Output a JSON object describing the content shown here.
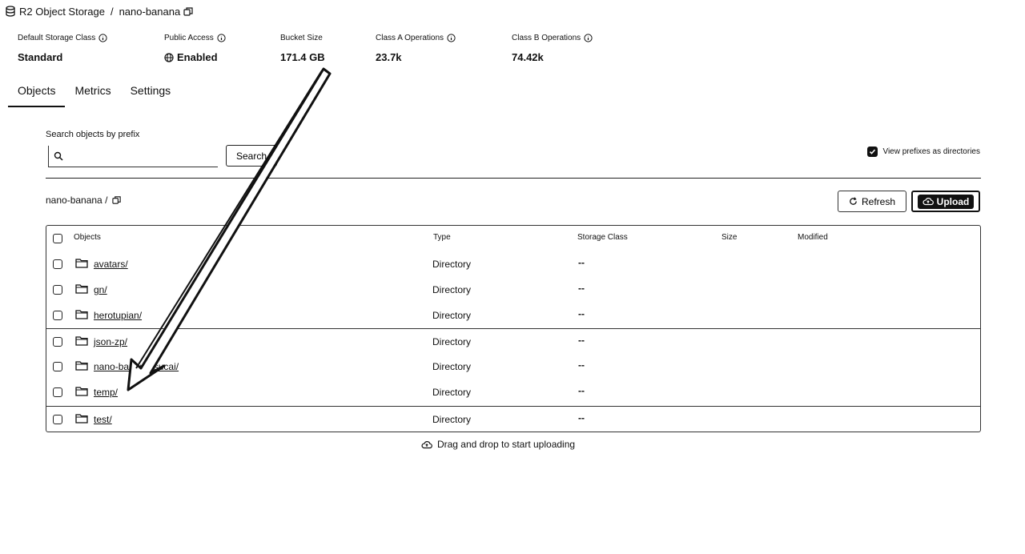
{
  "header": {
    "service": "R2 Object Storage",
    "separator": "/",
    "bucket": "nano-banana"
  },
  "stats": [
    {
      "label": "Default Storage Class",
      "value": "Standard",
      "info": true
    },
    {
      "label": "Public Access",
      "value": "Enabled",
      "info": true,
      "value_icon": "globe-icon"
    },
    {
      "label": "Bucket Size",
      "value": "171.4 GB",
      "info": false
    },
    {
      "label": "Class A Operations",
      "value": "23.7k",
      "info": true
    },
    {
      "label": "Class B Operations",
      "value": "74.42k",
      "info": true
    }
  ],
  "tabs": [
    {
      "label": "Objects",
      "active": true
    },
    {
      "label": "Metrics",
      "active": false
    },
    {
      "label": "Settings",
      "active": false
    }
  ],
  "search": {
    "label": "Search objects by prefix",
    "value": "",
    "placeholder": "",
    "button": "Search"
  },
  "view_prefixes": {
    "label": "View prefixes as directories",
    "checked": true
  },
  "path": {
    "text": "nano-banana /"
  },
  "actions": {
    "refresh": "Refresh",
    "upload": "Upload"
  },
  "table": {
    "columns": [
      "Objects",
      "Type",
      "Storage Class",
      "Size",
      "Modified"
    ],
    "rows": [
      {
        "name": "avatars/",
        "type": "Directory",
        "storage_class": "--"
      },
      {
        "name": "gn/",
        "type": "Directory",
        "storage_class": "--"
      },
      {
        "name": "herotupian/",
        "type": "Directory",
        "storage_class": "--"
      },
      {
        "name": "json-zp/",
        "type": "Directory",
        "storage_class": "--"
      },
      {
        "name": "nano-banana-sucai/",
        "type": "Directory",
        "storage_class": "--"
      },
      {
        "name": "temp/",
        "type": "Directory",
        "storage_class": "--"
      },
      {
        "name": "test/",
        "type": "Directory",
        "storage_class": "--"
      }
    ]
  },
  "dropzone": {
    "text": "Drag and drop to start uploading"
  },
  "colors": {
    "text": "#111111",
    "border": "#333333",
    "background": "#ffffff"
  }
}
